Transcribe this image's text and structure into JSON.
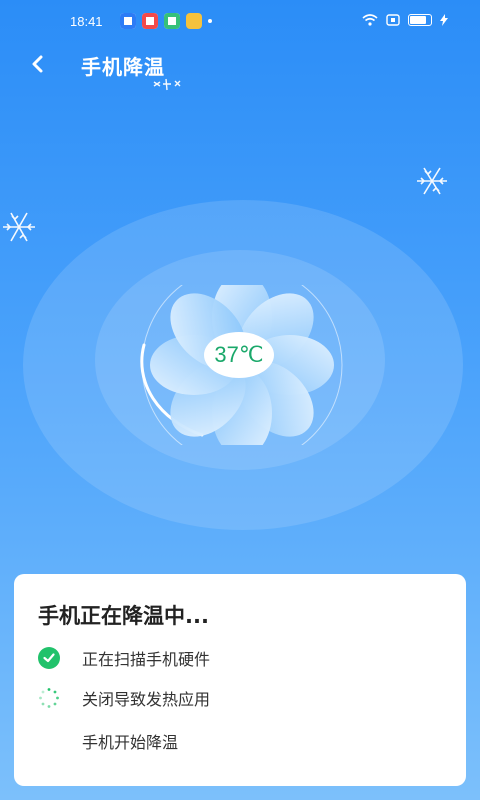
{
  "status_bar": {
    "time": "18:41"
  },
  "header": {
    "title": "手机降温"
  },
  "gauge": {
    "temperature": "37℃"
  },
  "card": {
    "title": "手机正在降温中...",
    "steps": [
      {
        "label": "正在扫描手机硬件",
        "state": "done"
      },
      {
        "label": "关闭导致发热应用",
        "state": "loading"
      },
      {
        "label": "手机开始降温",
        "state": "pending"
      }
    ]
  },
  "colors": {
    "accent_green": "#21c26b",
    "temp_text": "#1aa86a",
    "bg_top": "#2b8df7"
  },
  "icons": {
    "back": "chevron-left-icon",
    "snow": "snowflake-icon",
    "fan": "fan-icon"
  }
}
